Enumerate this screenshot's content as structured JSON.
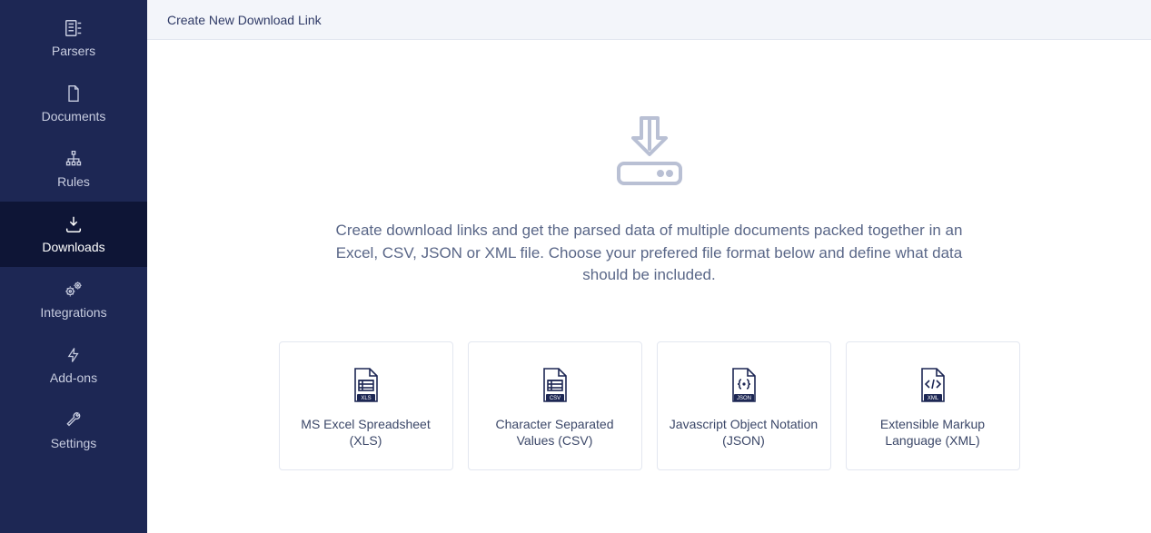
{
  "sidebar": {
    "items": [
      {
        "label": "Parsers"
      },
      {
        "label": "Documents"
      },
      {
        "label": "Rules"
      },
      {
        "label": "Downloads"
      },
      {
        "label": "Integrations"
      },
      {
        "label": "Add-ons"
      },
      {
        "label": "Settings"
      }
    ]
  },
  "topbar": {
    "title": "Create New Download Link"
  },
  "hero": {
    "description": "Create download links and get the parsed data of multiple documents packed together in an Excel, CSV, JSON or XML file. Choose your prefered file format below and define what data should be included."
  },
  "cards": [
    {
      "label": "MS Excel Spreadsheet (XLS)",
      "badge": "XLS"
    },
    {
      "label": "Character Separated Values (CSV)",
      "badge": "CSV"
    },
    {
      "label": "Javascript Object Notation (JSON)",
      "badge": "JSON"
    },
    {
      "label": "Extensible Markup Language (XML)",
      "badge": "XML"
    }
  ]
}
